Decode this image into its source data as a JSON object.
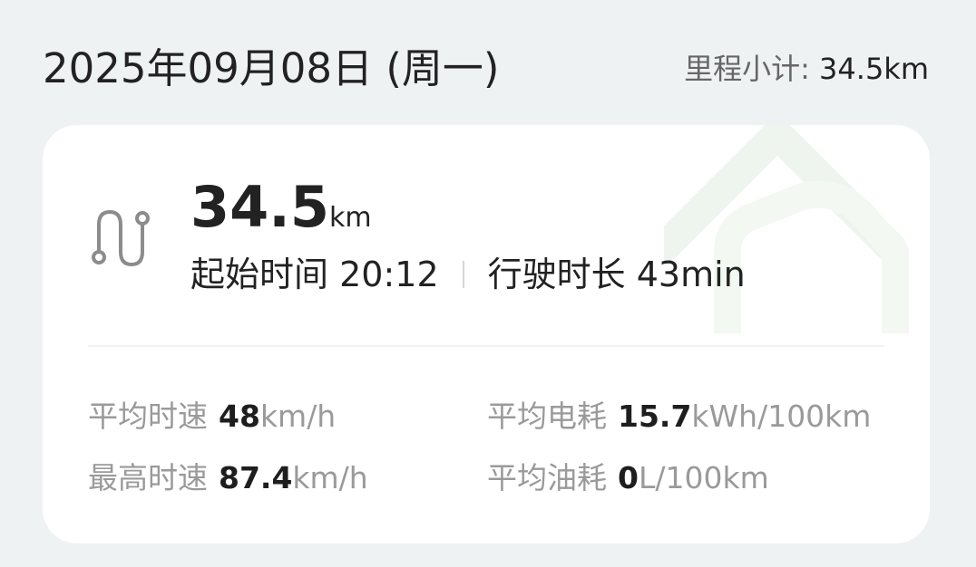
{
  "header": {
    "date": "2025年09月08日 (周一)",
    "subtotal_label": "里程小计:",
    "subtotal_value": "34.5km"
  },
  "trip": {
    "distance_value": "34.5",
    "distance_unit": "km",
    "start_label": "起始时间",
    "start_time": "20:12",
    "duration_label": "行驶时长",
    "duration_value": "43min"
  },
  "stats": {
    "avg_speed": {
      "label": "平均时速",
      "value": "48",
      "unit": "km/h"
    },
    "max_speed": {
      "label": "最高时速",
      "value": "87.4",
      "unit": "km/h"
    },
    "avg_energy": {
      "label": "平均电耗",
      "value": "15.7",
      "unit": "kWh/100km"
    },
    "avg_fuel": {
      "label": "平均油耗",
      "value": "0",
      "unit": "L/100km"
    }
  },
  "icons": {
    "route": "route-icon",
    "watermark": "house-watermark-icon"
  },
  "colors": {
    "background": "#eff2f3",
    "card": "#ffffff",
    "primary_text": "#222222",
    "secondary_text": "#9a9a9a",
    "watermark": "#eef5ef"
  }
}
